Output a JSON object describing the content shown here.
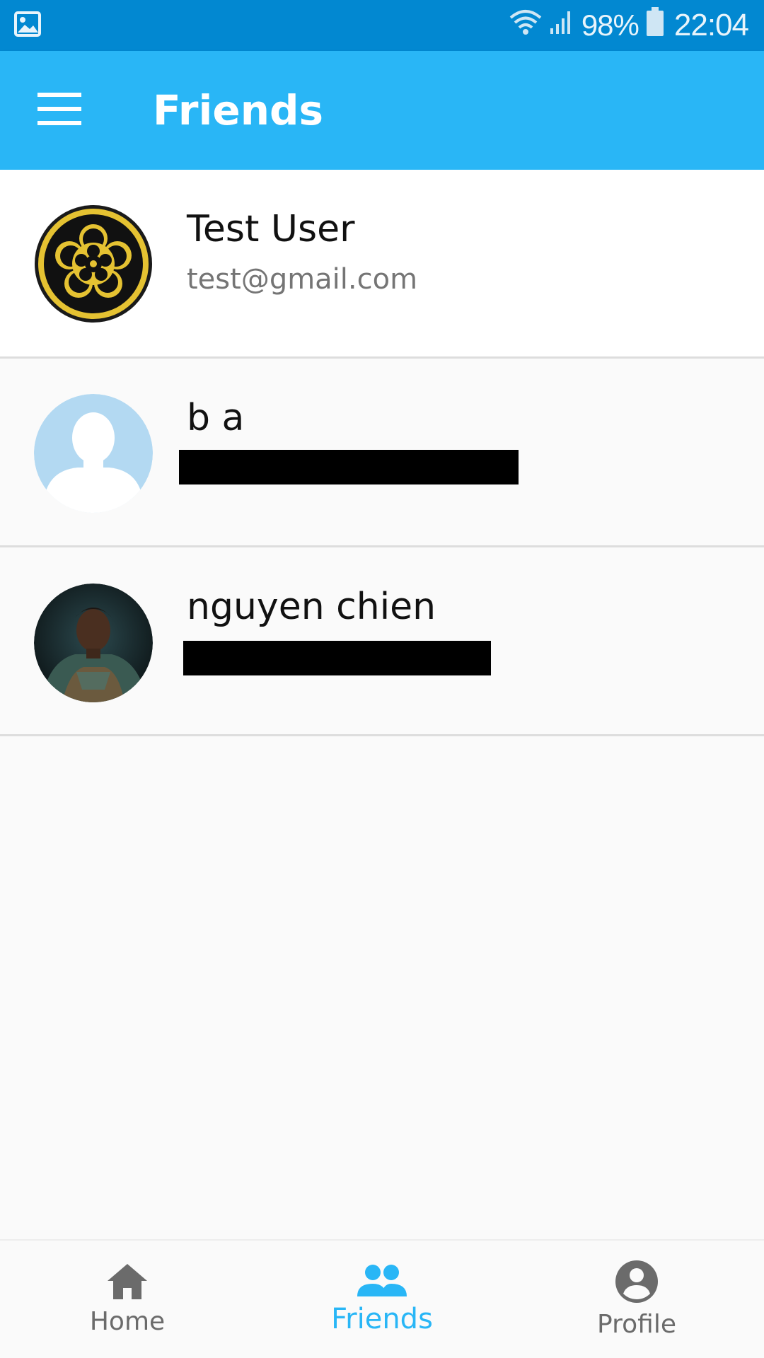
{
  "status_bar": {
    "battery_percent": "98%",
    "time": "22:04",
    "icons": [
      "gallery-icon",
      "wifi-icon",
      "signal-icon",
      "battery-icon"
    ]
  },
  "app_bar": {
    "title": "Friends",
    "menu_icon": "hamburger-menu-icon",
    "color": "#29b6f6"
  },
  "friends": [
    {
      "name": "Test User",
      "email": "test@gmail.com",
      "avatar": "crest-avatar"
    },
    {
      "name": "b a",
      "email": "",
      "avatar": "default-person-avatar"
    },
    {
      "name": "nguyen chien",
      "email": "",
      "avatar": "photo-avatar"
    }
  ],
  "bottom_nav": {
    "items": [
      {
        "label": "Home",
        "icon": "home-icon",
        "active": false
      },
      {
        "label": "Friends",
        "icon": "people-icon",
        "active": true
      },
      {
        "label": "Profile",
        "icon": "account-circle-icon",
        "active": false
      }
    ],
    "active_color": "#29b6f6",
    "inactive_color": "#6b6b6b"
  }
}
